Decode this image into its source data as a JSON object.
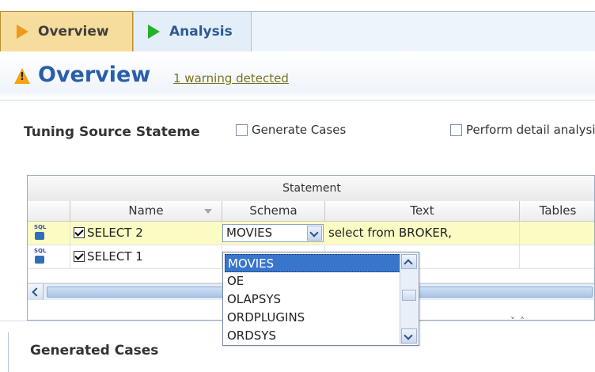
{
  "tabs": [
    {
      "label": "Overview",
      "icon": "orange-play-icon"
    },
    {
      "label": "Analysis",
      "icon": "green-play-icon"
    }
  ],
  "header": {
    "title": "Overview",
    "warning_link": "1 warning detected",
    "warning_icon": "warning-icon"
  },
  "section": {
    "title": "Tuning Source Statements",
    "options": [
      {
        "label": "Generate Cases",
        "checked": false
      },
      {
        "label": "Perform detail analysis",
        "checked": false
      }
    ]
  },
  "grid": {
    "group_header": "Statement",
    "columns": [
      "",
      "Name",
      "Schema",
      "Text",
      "Tables"
    ],
    "rows": [
      {
        "icon_text": "SQL",
        "name": "SELECT 2",
        "checked": true,
        "schema": "MOVIES",
        "text": "select from BROKER,",
        "selected": true
      },
      {
        "icon_text": "SQL",
        "name": "SELECT 1",
        "checked": true,
        "schema": "",
        "text": "",
        "selected": false
      }
    ]
  },
  "schema_dropdown": {
    "options": [
      "MOVIES",
      "OE",
      "OLAPSYS",
      "ORDPLUGINS",
      "ORDSYS"
    ],
    "highlighted": "MOVIES"
  },
  "bottom": {
    "title": "Generated Cases"
  },
  "colors": {
    "overview_tab_bg": "#f6dc9d",
    "analysis_tab_bg": "#e4eef8",
    "title_blue": "#2a5fa8",
    "selected_row": "#fbfbc4",
    "dropdown_highlight": "#3876cc"
  }
}
